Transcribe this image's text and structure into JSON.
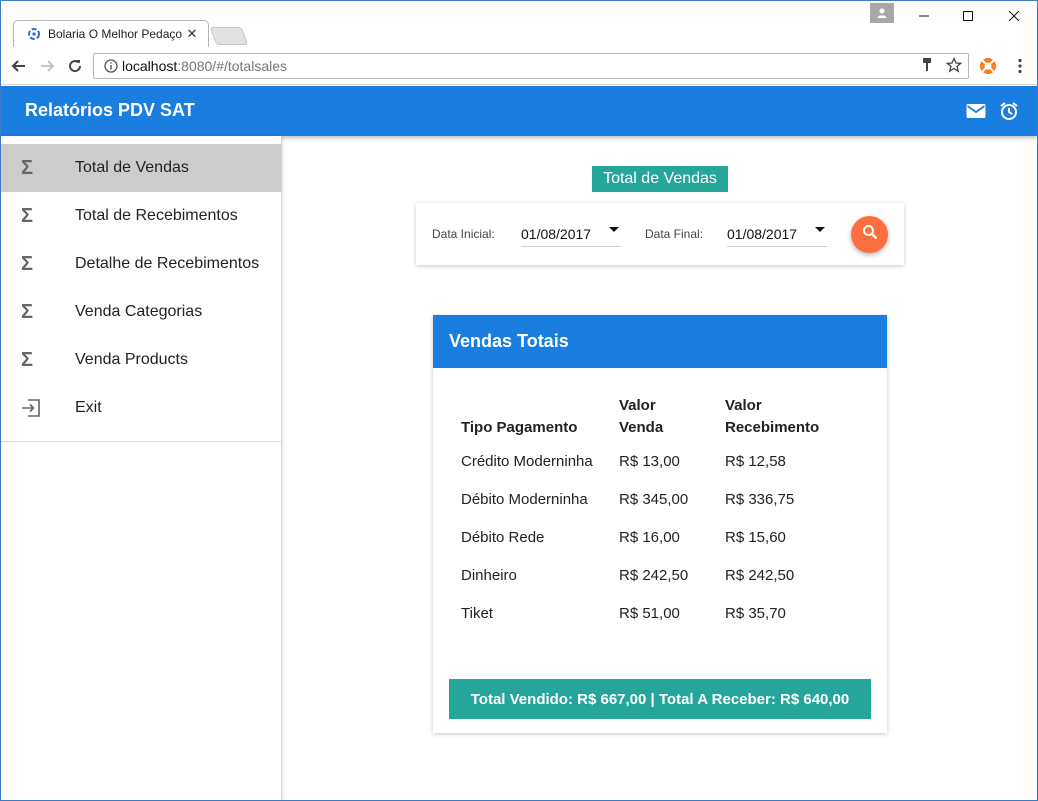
{
  "browser": {
    "tab_title": "Bolaria O Melhor Pedaço",
    "url_host": "localhost",
    "url_rest": ":8080/#/totalsales"
  },
  "appbar": {
    "title": "Relatórios PDV SAT"
  },
  "sidebar": {
    "items": [
      {
        "label": "Total de Vendas",
        "icon": "sigma-icon",
        "active": true
      },
      {
        "label": "Total de Recebimentos",
        "icon": "sigma-icon"
      },
      {
        "label": "Detalhe de Recebimentos",
        "icon": "sigma-icon"
      },
      {
        "label": "Venda Categorias",
        "icon": "sigma-icon"
      },
      {
        "label": "Venda Products",
        "icon": "sigma-icon"
      },
      {
        "label": "Exit",
        "icon": "exit-icon"
      }
    ]
  },
  "main": {
    "badge": "Total de Vendas",
    "filter": {
      "start_label": "Data Inicial:",
      "start_value": "01/08/2017",
      "end_label": "Data Final:",
      "end_value": "01/08/2017"
    },
    "card": {
      "title": "Vendas Totais",
      "headers": [
        "Tipo Pagamento",
        "Valor Venda",
        "Valor Recebimento"
      ],
      "rows": [
        [
          "Crédito Moderninha",
          "R$ 13,00",
          "R$ 12,58"
        ],
        [
          "Débito Moderninha",
          "R$ 345,00",
          "R$ 336,75"
        ],
        [
          "Débito Rede",
          "R$ 16,00",
          "R$ 15,60"
        ],
        [
          "Dinheiro",
          "R$ 242,50",
          "R$ 242,50"
        ],
        [
          "Tiket",
          "R$ 51,00",
          "R$ 35,70"
        ]
      ],
      "total": "Total Vendido: R$ 667,00 | Total A Receber: R$ 640,00"
    }
  },
  "colors": {
    "primary": "#1a7de0",
    "teal": "#26a69a",
    "fab": "#ff6e40",
    "active_item": "#cccccc"
  }
}
